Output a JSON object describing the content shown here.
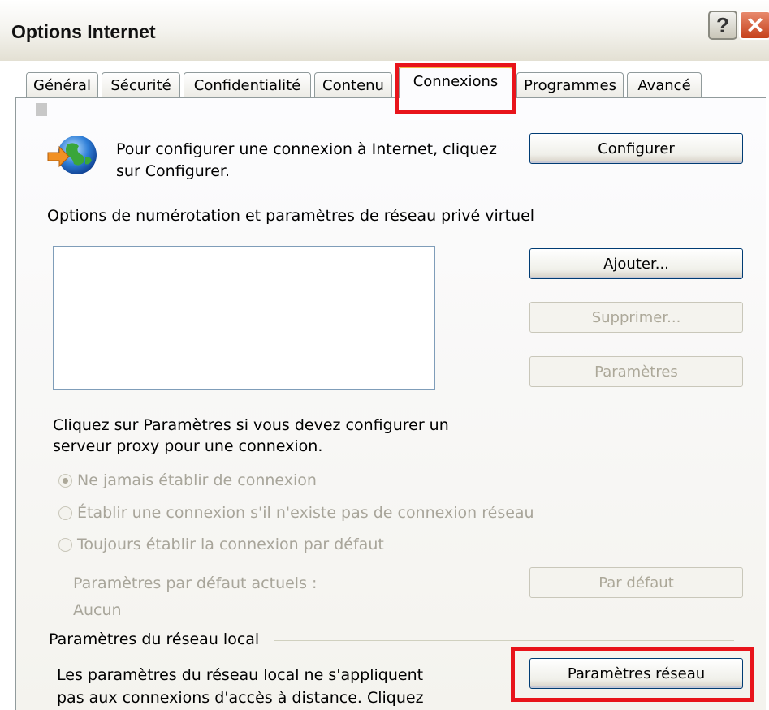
{
  "window": {
    "title": "Options Internet",
    "help_glyph": "?",
    "close_glyph": "✕"
  },
  "tabs": [
    {
      "label": "Général"
    },
    {
      "label": "Sécurité"
    },
    {
      "label": "Confidentialité"
    },
    {
      "label": "Contenu"
    },
    {
      "label": "Connexions",
      "active": true
    },
    {
      "label": "Programmes"
    },
    {
      "label": "Avancé"
    }
  ],
  "setup": {
    "text_line1": "Pour configurer une connexion à Internet, cliquez",
    "text_line2": "sur Configurer.",
    "button": "Configurer",
    "icon": "globe-connect-icon"
  },
  "dialup": {
    "group_label": "Options de numérotation et paramètres de réseau privé virtuel",
    "add_button": "Ajouter...",
    "remove_button": "Supprimer...",
    "settings_button": "Paramètres",
    "help_line1": "Cliquez sur Paramètres si vous devez configurer un",
    "help_line2": "serveur proxy pour une connexion.",
    "options": [
      {
        "label": "Ne jamais établir de connexion",
        "checked": true
      },
      {
        "label": "Établir une connexion s'il n'existe pas de connexion réseau",
        "checked": false
      },
      {
        "label": "Toujours établir la connexion par défaut",
        "checked": false
      }
    ],
    "default_label": "Paramètres par défaut actuels :",
    "default_value": "Aucun",
    "default_button": "Par défaut"
  },
  "lan": {
    "group_label": "Paramètres du réseau local",
    "text_line1": "Les paramètres du réseau local ne s'appliquent",
    "text_line2": "pas aux connexions d'accès à distance. Cliquez",
    "button": "Paramètres réseau"
  },
  "colors": {
    "highlight": "#e8141b",
    "active_tab_accent": "#f5b447",
    "button_border": "#003c74"
  }
}
